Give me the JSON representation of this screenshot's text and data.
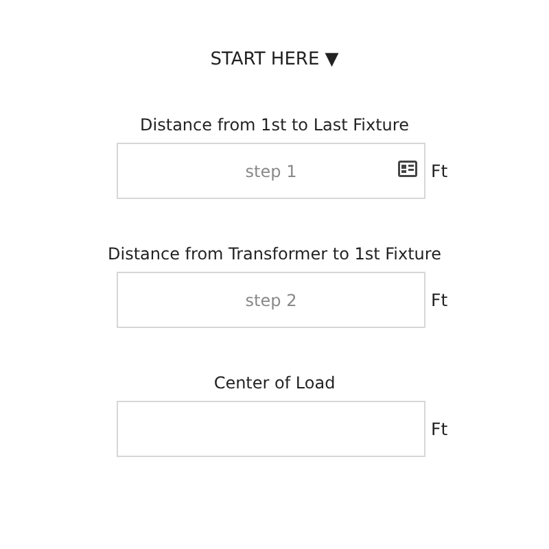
{
  "header": {
    "label": "START HERE ▼"
  },
  "fields": [
    {
      "label": "Distance from 1st to Last Fixture",
      "placeholder": "step 1",
      "card_icon": true,
      "unit": "Ft"
    },
    {
      "label": "Distance from Transformer to 1st Fixture",
      "placeholder": "step 2",
      "card_icon": false,
      "unit": "Ft"
    },
    {
      "label": "Center of Load",
      "card_icon": false,
      "unit": "Ft"
    }
  ]
}
